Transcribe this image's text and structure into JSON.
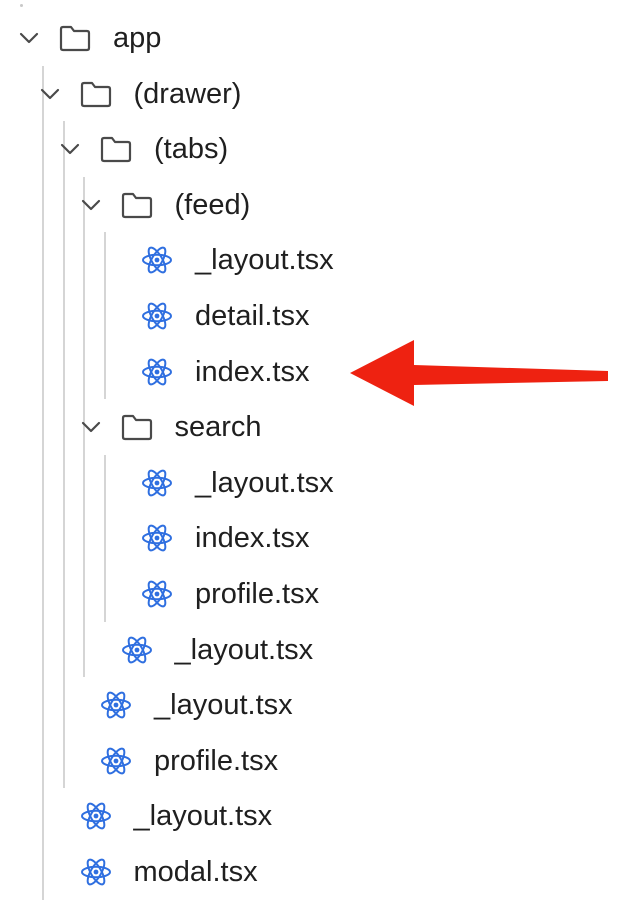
{
  "tree": [
    {
      "label": "app",
      "type": "folder",
      "depth": 0,
      "expanded": true
    },
    {
      "label": "(drawer)",
      "type": "folder",
      "depth": 1,
      "expanded": true
    },
    {
      "label": "(tabs)",
      "type": "folder",
      "depth": 2,
      "expanded": true
    },
    {
      "label": "(feed)",
      "type": "folder",
      "depth": 3,
      "expanded": true
    },
    {
      "label": "_layout.tsx",
      "type": "file",
      "depth": 4
    },
    {
      "label": "detail.tsx",
      "type": "file",
      "depth": 4
    },
    {
      "label": "index.tsx",
      "type": "file",
      "depth": 4,
      "highlighted": true
    },
    {
      "label": "search",
      "type": "folder",
      "depth": 3,
      "expanded": true
    },
    {
      "label": "_layout.tsx",
      "type": "file",
      "depth": 4
    },
    {
      "label": "index.tsx",
      "type": "file",
      "depth": 4
    },
    {
      "label": "profile.tsx",
      "type": "file",
      "depth": 4
    },
    {
      "label": "_layout.tsx",
      "type": "file",
      "depth": 3
    },
    {
      "label": "_layout.tsx",
      "type": "file",
      "depth": 2
    },
    {
      "label": "profile.tsx",
      "type": "file",
      "depth": 2
    },
    {
      "label": "_layout.tsx",
      "type": "file",
      "depth": 1
    },
    {
      "label": "modal.tsx",
      "type": "file",
      "depth": 1
    }
  ],
  "colors": {
    "folder_stroke": "#4a4a4a",
    "react_icon": "#2f6fe0",
    "arrow": "#ee2211",
    "guide_line": "#d5d5d5",
    "text": "#1f1f1f"
  },
  "icons": {
    "folder": "folder-icon",
    "file": "react-icon",
    "chevron": "chevron-down-icon",
    "annotation": "arrow-left-icon"
  }
}
